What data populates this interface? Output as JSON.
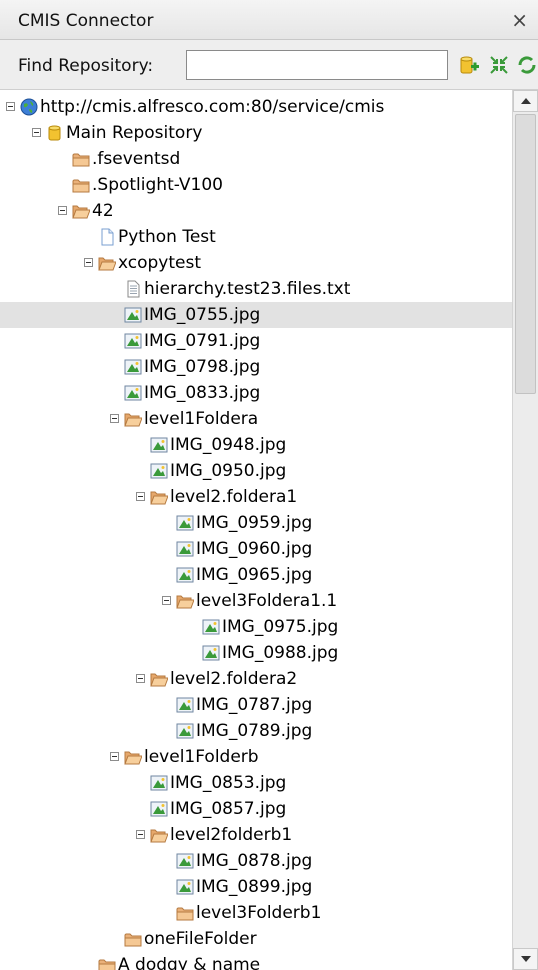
{
  "window": {
    "title": "CMIS Connector",
    "close_glyph": "×"
  },
  "search": {
    "label": "Find Repository:",
    "value": "",
    "placeholder": "",
    "icons": [
      "add-repository-icon",
      "collapse-all-icon",
      "refresh-icon"
    ]
  },
  "tree": [
    {
      "label": "http://cmis.alfresco.com:80/service/cmis",
      "icon": "globe",
      "depth": 0,
      "expanded": true
    },
    {
      "label": "Main Repository",
      "icon": "database",
      "depth": 1,
      "expanded": true
    },
    {
      "label": ".fseventsd",
      "icon": "folder",
      "depth": 2
    },
    {
      "label": ".Spotlight-V100",
      "icon": "folder",
      "depth": 2
    },
    {
      "label": "42",
      "icon": "folder-open",
      "depth": 2,
      "expanded": true
    },
    {
      "label": "Python Test",
      "icon": "document",
      "depth": 3
    },
    {
      "label": "xcopytest",
      "icon": "folder-open",
      "depth": 3,
      "expanded": true
    },
    {
      "label": "hierarchy.test23.files.txt",
      "icon": "text-file",
      "depth": 4
    },
    {
      "label": "IMG_0755.jpg",
      "icon": "image",
      "depth": 4,
      "selected": true
    },
    {
      "label": "IMG_0791.jpg",
      "icon": "image",
      "depth": 4
    },
    {
      "label": "IMG_0798.jpg",
      "icon": "image",
      "depth": 4
    },
    {
      "label": "IMG_0833.jpg",
      "icon": "image",
      "depth": 4
    },
    {
      "label": "level1Foldera",
      "icon": "folder-open",
      "depth": 4,
      "expanded": true
    },
    {
      "label": "IMG_0948.jpg",
      "icon": "image",
      "depth": 5
    },
    {
      "label": "IMG_0950.jpg",
      "icon": "image",
      "depth": 5
    },
    {
      "label": "level2.foldera1",
      "icon": "folder-open",
      "depth": 5,
      "expanded": true
    },
    {
      "label": "IMG_0959.jpg",
      "icon": "image",
      "depth": 6
    },
    {
      "label": "IMG_0960.jpg",
      "icon": "image",
      "depth": 6
    },
    {
      "label": "IMG_0965.jpg",
      "icon": "image",
      "depth": 6
    },
    {
      "label": "level3Foldera1.1",
      "icon": "folder-open",
      "depth": 6,
      "expanded": true
    },
    {
      "label": "IMG_0975.jpg",
      "icon": "image",
      "depth": 7
    },
    {
      "label": "IMG_0988.jpg",
      "icon": "image",
      "depth": 7
    },
    {
      "label": "level2.foldera2",
      "icon": "folder-open",
      "depth": 5,
      "expanded": true
    },
    {
      "label": "IMG_0787.jpg",
      "icon": "image",
      "depth": 6
    },
    {
      "label": "IMG_0789.jpg",
      "icon": "image",
      "depth": 6
    },
    {
      "label": "level1Folderb",
      "icon": "folder-open",
      "depth": 4,
      "expanded": true
    },
    {
      "label": "IMG_0853.jpg",
      "icon": "image",
      "depth": 5
    },
    {
      "label": "IMG_0857.jpg",
      "icon": "image",
      "depth": 5
    },
    {
      "label": "level2folderb1",
      "icon": "folder-open",
      "depth": 5,
      "expanded": true
    },
    {
      "label": "IMG_0878.jpg",
      "icon": "image",
      "depth": 6
    },
    {
      "label": "IMG_0899.jpg",
      "icon": "image",
      "depth": 6
    },
    {
      "label": "level3Folderb1",
      "icon": "folder",
      "depth": 6
    },
    {
      "label": "oneFileFolder",
      "icon": "folder",
      "depth": 4
    },
    {
      "label": "A dodgy & name",
      "icon": "folder",
      "depth": 3
    }
  ]
}
